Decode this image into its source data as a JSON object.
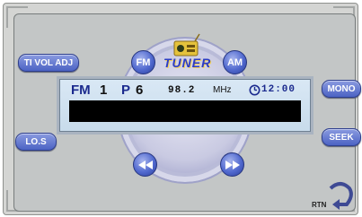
{
  "buttons": {
    "ti_vol_adj": "TI VOL ADJ",
    "fm": "FM",
    "am": "AM",
    "mono": "MONO",
    "los": "LO.S",
    "seek": "SEEK",
    "rtn": "RTN"
  },
  "logo_text": "TUNER",
  "display": {
    "band": "FM",
    "band_number": "1",
    "preset_prefix": "P",
    "preset_number": "6",
    "frequency": "98.2",
    "unit": "MHz",
    "time": "12:00"
  },
  "icons": [
    "rewind-icon",
    "fast-forward-icon",
    "clock-icon",
    "radio-icon",
    "return-arrow-icon"
  ],
  "colors": {
    "button_blue": "#4c63c4",
    "display_text": "#1b2a8e",
    "display_bg": "#d9e8f5",
    "lcd": "#000000"
  }
}
